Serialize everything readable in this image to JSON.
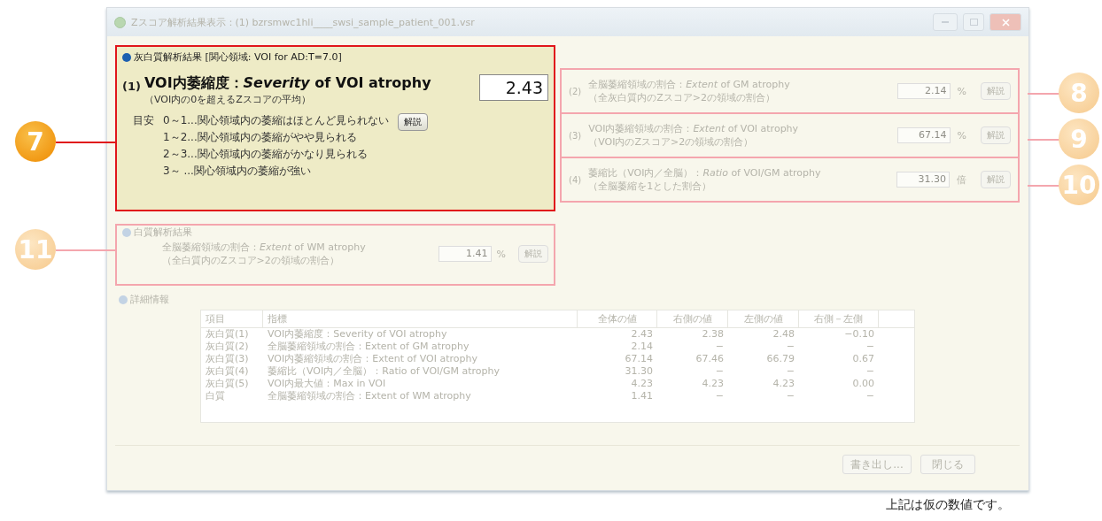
{
  "window": {
    "title": "Zスコア解析結果表示：(1) bzrsmwc1hli____swsi_sample_patient_001.vsr"
  },
  "gm_section": {
    "title": "灰白質解析結果 [関心領域: VOI for AD:T=7.0]",
    "primary": {
      "index": "(1)",
      "label": "VOI内萎縮度：*Severity* of VOI atrophy",
      "sublabel": "（VOI内の0を超えるZスコアの平均）",
      "value": "2.43",
      "guide_label": "目安",
      "guide": [
        "0～1...関心領域内の萎縮はほとんど見られない",
        "1～2...関心領域内の萎縮がやや見られる",
        "2～3...関心領域内の萎縮がかなり見られる",
        "3～ ...関心領域内の萎縮が強い"
      ],
      "button": "解説",
      "highlighted": true,
      "callout": "7"
    },
    "rows": [
      {
        "index": "(2)",
        "label": "全脳萎縮領域の割合：*Extent* of GM atrophy",
        "sublabel": "（全灰白質内のZスコア>2の領域の割合）",
        "value": "2.14",
        "unit": "%",
        "button": "解説",
        "highlighted": false,
        "callout": "8"
      },
      {
        "index": "(3)",
        "label": "VOI内萎縮領域の割合：*Extent* of VOI atrophy",
        "sublabel": "（VOI内のZスコア>2の領域の割合）",
        "value": "67.14",
        "unit": "%",
        "button": "解説",
        "highlighted": false,
        "callout": "9"
      },
      {
        "index": "(4)",
        "label": "萎縮比（VOI内／全脳）：*Ratio* of VOI/GM atrophy",
        "sublabel": "（全脳萎縮を1とした割合）",
        "value": "31.30",
        "unit": "倍",
        "button": "解説",
        "highlighted": false,
        "callout": "10"
      }
    ]
  },
  "wm_section": {
    "title": "白質解析結果",
    "label": "全脳萎縮領域の割合：*Extent* of WM atrophy",
    "sublabel": "（全白質内のZスコア>2の領域の割合）",
    "value": "1.41",
    "unit": "%",
    "button": "解説",
    "highlighted": false,
    "callout": "11"
  },
  "details": {
    "title": "詳細情報",
    "columns": [
      "項目",
      "指標",
      "全体の値",
      "右側の値",
      "左側の値",
      "右側－左側"
    ],
    "rows": [
      [
        "灰白質(1)",
        "VOI内萎縮度：Severity of VOI atrophy",
        "2.43",
        "2.38",
        "2.48",
        "−0.10"
      ],
      [
        "灰白質(2)",
        "全脳萎縮領域の割合：Extent of GM atrophy",
        "2.14",
        "−",
        "−",
        "−"
      ],
      [
        "灰白質(3)",
        "VOI内萎縮領域の割合：Extent of VOI atrophy",
        "67.14",
        "67.46",
        "66.79",
        "0.67"
      ],
      [
        "灰白質(4)",
        "萎縮比（VOI内／全脳）：Ratio of VOI/GM atrophy",
        "31.30",
        "−",
        "−",
        "−"
      ],
      [
        "灰白質(5)",
        "VOI内最大値：Max in VOI",
        "4.23",
        "4.23",
        "4.23",
        "0.00"
      ],
      [
        "白質",
        "全脳萎縮領域の割合：Extent of WM atrophy",
        "1.41",
        "−",
        "−",
        "−"
      ]
    ]
  },
  "buttons": [
    "書き出し...",
    "閉じる"
  ],
  "note": "上記は仮の数値です。"
}
